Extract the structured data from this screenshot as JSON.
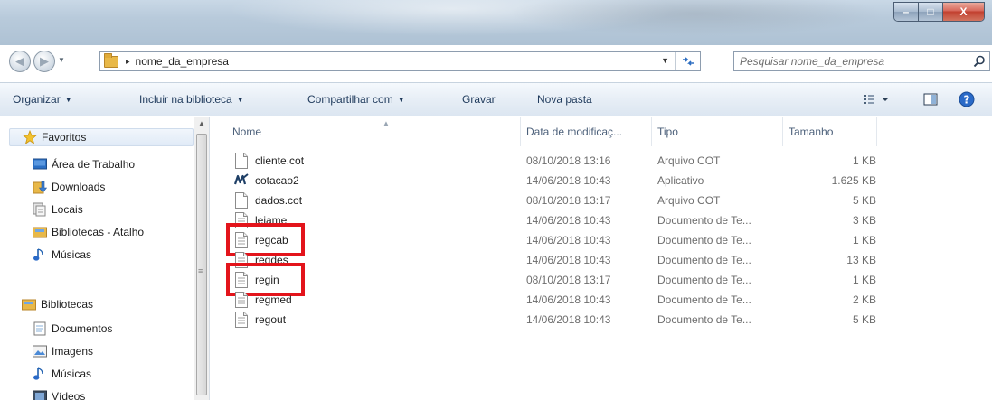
{
  "window": {
    "controls": {
      "minimize": "–",
      "maximize": "□",
      "close": "X"
    }
  },
  "address": {
    "separator": "▸",
    "path": "nome_da_empresa",
    "search_placeholder": "Pesquisar nome_da_empresa"
  },
  "toolbar": {
    "organize": "Organizar",
    "include_library": "Incluir na biblioteca",
    "share_with": "Compartilhar com",
    "burn": "Gravar",
    "new_folder": "Nova pasta"
  },
  "sidebar": {
    "favorites": {
      "label": "Favoritos",
      "items": [
        {
          "label": "Área de Trabalho",
          "icon": "desktop-icon"
        },
        {
          "label": "Downloads",
          "icon": "downloads-icon"
        },
        {
          "label": "Locais",
          "icon": "recent-places-icon"
        },
        {
          "label": "Bibliotecas - Atalho",
          "icon": "library-shortcut-icon"
        },
        {
          "label": "Músicas",
          "icon": "music-icon"
        }
      ]
    },
    "libraries": {
      "label": "Bibliotecas",
      "items": [
        {
          "label": "Documentos",
          "icon": "documents-icon"
        },
        {
          "label": "Imagens",
          "icon": "pictures-icon"
        },
        {
          "label": "Músicas",
          "icon": "music-icon"
        },
        {
          "label": "Vídeos",
          "icon": "videos-icon"
        }
      ]
    }
  },
  "columns": {
    "name": "Nome",
    "date": "Data de modificaç...",
    "type": "Tipo",
    "size": "Tamanho"
  },
  "files": [
    {
      "name": "cliente.cot",
      "date": "08/10/2018 13:16",
      "type": "Arquivo COT",
      "size": "1 KB",
      "icon": "blank-file-icon"
    },
    {
      "name": "cotacao2",
      "date": "14/06/2018 10:43",
      "type": "Aplicativo",
      "size": "1.625 KB",
      "icon": "application-icon"
    },
    {
      "name": "dados.cot",
      "date": "08/10/2018 13:17",
      "type": "Arquivo COT",
      "size": "5 KB",
      "icon": "blank-file-icon"
    },
    {
      "name": "leiame",
      "date": "14/06/2018 10:43",
      "type": "Documento de Te...",
      "size": "3 KB",
      "icon": "text-file-icon"
    },
    {
      "name": "regcab",
      "date": "14/06/2018 10:43",
      "type": "Documento de Te...",
      "size": "1 KB",
      "icon": "text-file-icon",
      "highlighted": true
    },
    {
      "name": "regdes",
      "date": "14/06/2018 10:43",
      "type": "Documento de Te...",
      "size": "13 KB",
      "icon": "text-file-icon"
    },
    {
      "name": "regin",
      "date": "08/10/2018 13:17",
      "type": "Documento de Te...",
      "size": "1 KB",
      "icon": "text-file-icon",
      "highlighted": true
    },
    {
      "name": "regmed",
      "date": "14/06/2018 10:43",
      "type": "Documento de Te...",
      "size": "2 KB",
      "icon": "text-file-icon"
    },
    {
      "name": "regout",
      "date": "14/06/2018 10:43",
      "type": "Documento de Te...",
      "size": "5 KB",
      "icon": "text-file-icon"
    }
  ],
  "colors": {
    "highlight": "#e3141b",
    "toolbar_text": "#1e395b",
    "meta_text": "#6d6d6d"
  }
}
